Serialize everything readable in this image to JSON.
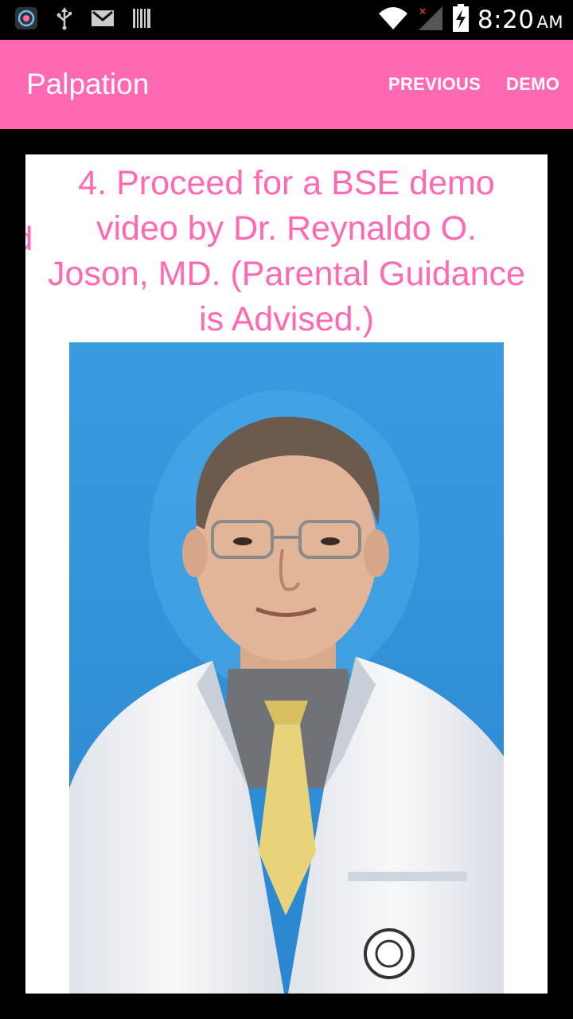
{
  "status_bar": {
    "time": "8:20",
    "ampm": "AM",
    "icons": [
      "app-notification-icon",
      "usb-icon",
      "gmail-icon",
      "barcode-icon",
      "wifi-icon",
      "cell-signal-icon",
      "battery-charging-icon"
    ]
  },
  "app_bar": {
    "title": "Palpation",
    "actions": {
      "previous": "PREVIOUS",
      "demo": "DEMO"
    }
  },
  "page": {
    "peek_text": "d",
    "step_text": "4. Proceed for a BSE demo video by Dr. Reynaldo O. Joson, MD. (Parental Guidance is Advised.)",
    "photo_subject": "doctor-portrait"
  },
  "colors": {
    "accent": "#ff69b4",
    "photo_background": "#2f8fd6",
    "coat": "#f2f4f7",
    "tie": "#e8d27a"
  }
}
